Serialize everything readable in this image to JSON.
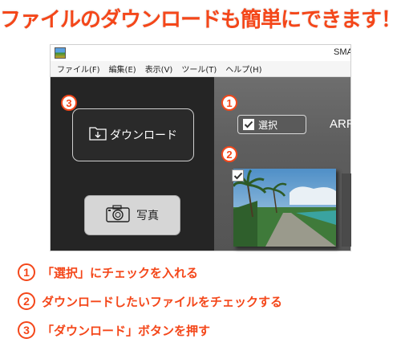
{
  "headline": "ファイルのダウンロードも簡単にできます！",
  "window": {
    "title": "SMA",
    "menu": [
      "ファイル(F)",
      "編集(E)",
      "表示(V)",
      "ツール(T)",
      "ヘルプ(H)"
    ]
  },
  "left_panel": {
    "download_button_label": "ダウンロード",
    "photo_button_label": "写真"
  },
  "right_panel": {
    "select_label": "選択",
    "select_checked": true,
    "arr_label": "ARR",
    "thumbnail_checked": true
  },
  "callouts": {
    "one": "1",
    "two": "2",
    "three": "3"
  },
  "steps": [
    {
      "number": "1",
      "text": "「選択」にチェックを入れる"
    },
    {
      "number": "2",
      "text": "ダウンロードしたいファイルをチェックする"
    },
    {
      "number": "3",
      "text": "「ダウンロード」ボタンを押す"
    }
  ],
  "colors": {
    "accent": "#f4471a",
    "panel_dark": "#252525",
    "panel_gray": "#5e5e5e"
  },
  "icons": [
    "app-icon",
    "folder-download-icon",
    "camera-icon",
    "checkbox-checked-icon"
  ]
}
